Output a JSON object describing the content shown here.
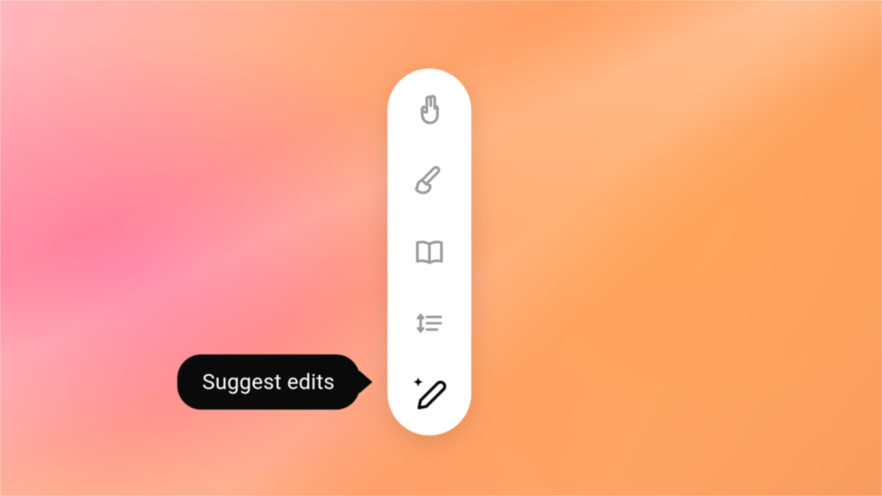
{
  "toolbar": {
    "items": [
      {
        "name": "peace-hand",
        "active": false
      },
      {
        "name": "brush",
        "active": false
      },
      {
        "name": "book",
        "active": false
      },
      {
        "name": "line-spacing",
        "active": false
      },
      {
        "name": "suggest-edits",
        "active": true
      }
    ]
  },
  "tooltip": {
    "label": "Suggest edits"
  },
  "colors": {
    "toolbar_bg": "#ffffff",
    "icon_inactive": "#9a9a9a",
    "icon_active": "#0a0a0a",
    "tooltip_bg": "#0a0a0a",
    "tooltip_text": "#ffffff"
  }
}
